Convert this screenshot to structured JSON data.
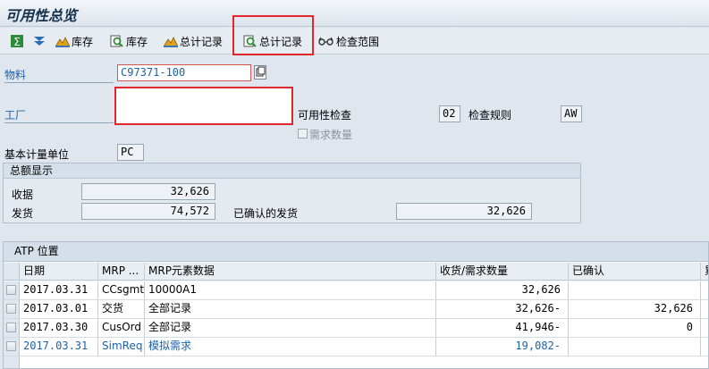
{
  "window": {
    "title": "可用性总览"
  },
  "toolbar": {
    "buttons": [
      {
        "label": "",
        "icon": "sum-icon"
      },
      {
        "label": "",
        "icon": "filter-icon"
      },
      {
        "label": "库存",
        "icon": "stock-mountain-icon"
      },
      {
        "label": "库存",
        "icon": "stock-search-icon"
      },
      {
        "label": "总计记录",
        "icon": "total-mountain-icon"
      },
      {
        "label": "总计记录",
        "icon": "total-search-icon"
      },
      {
        "label": "检查范围",
        "icon": "glasses-icon"
      }
    ]
  },
  "form": {
    "material_label": "物料",
    "material_value": "C97371-100",
    "plant_label": "工厂",
    "plant_value": "",
    "availability_check_label": "可用性检查",
    "availability_check_value": "02",
    "check_rule_label": "检查规则",
    "check_rule_value": "AW",
    "req_qty_label": "需求数量",
    "base_unit_label": "基本计量单位",
    "base_unit_value": "PC"
  },
  "totals": {
    "title": "总额显示",
    "receipts_label": "收据",
    "receipts_value": "32,626",
    "issues_label": "发货",
    "issues_value": "74,572",
    "confirmed_issues_label": "已确认的发货",
    "confirmed_issues_value": "32,626"
  },
  "atp": {
    "title": "ATP 位置",
    "headers": [
      "日期",
      "MRP ...",
      "MRP元素数据",
      "收货/需求数量",
      "已确认",
      "累"
    ],
    "rows": [
      {
        "date": "2017.03.31",
        "mrp": "CCsgmt",
        "data": "10000A1",
        "qty": "32,626",
        "confirmed": "",
        "blue": false
      },
      {
        "date": "2017.03.01",
        "mrp": "交货",
        "data": "全部记录",
        "qty": "32,626-",
        "confirmed": "32,626",
        "blue": false
      },
      {
        "date": "2017.03.30",
        "mrp": "CusOrd",
        "data": "全部记录",
        "qty": "41,946-",
        "confirmed": "0",
        "blue": false
      },
      {
        "date": "2017.03.31",
        "mrp": "SimReq",
        "data": "模拟需求",
        "qty": "19,082-",
        "confirmed": "",
        "blue": true
      }
    ]
  },
  "colors": {
    "highlight": "#e3262b",
    "link": "#1d62a8",
    "background": "#dfe6ee"
  }
}
